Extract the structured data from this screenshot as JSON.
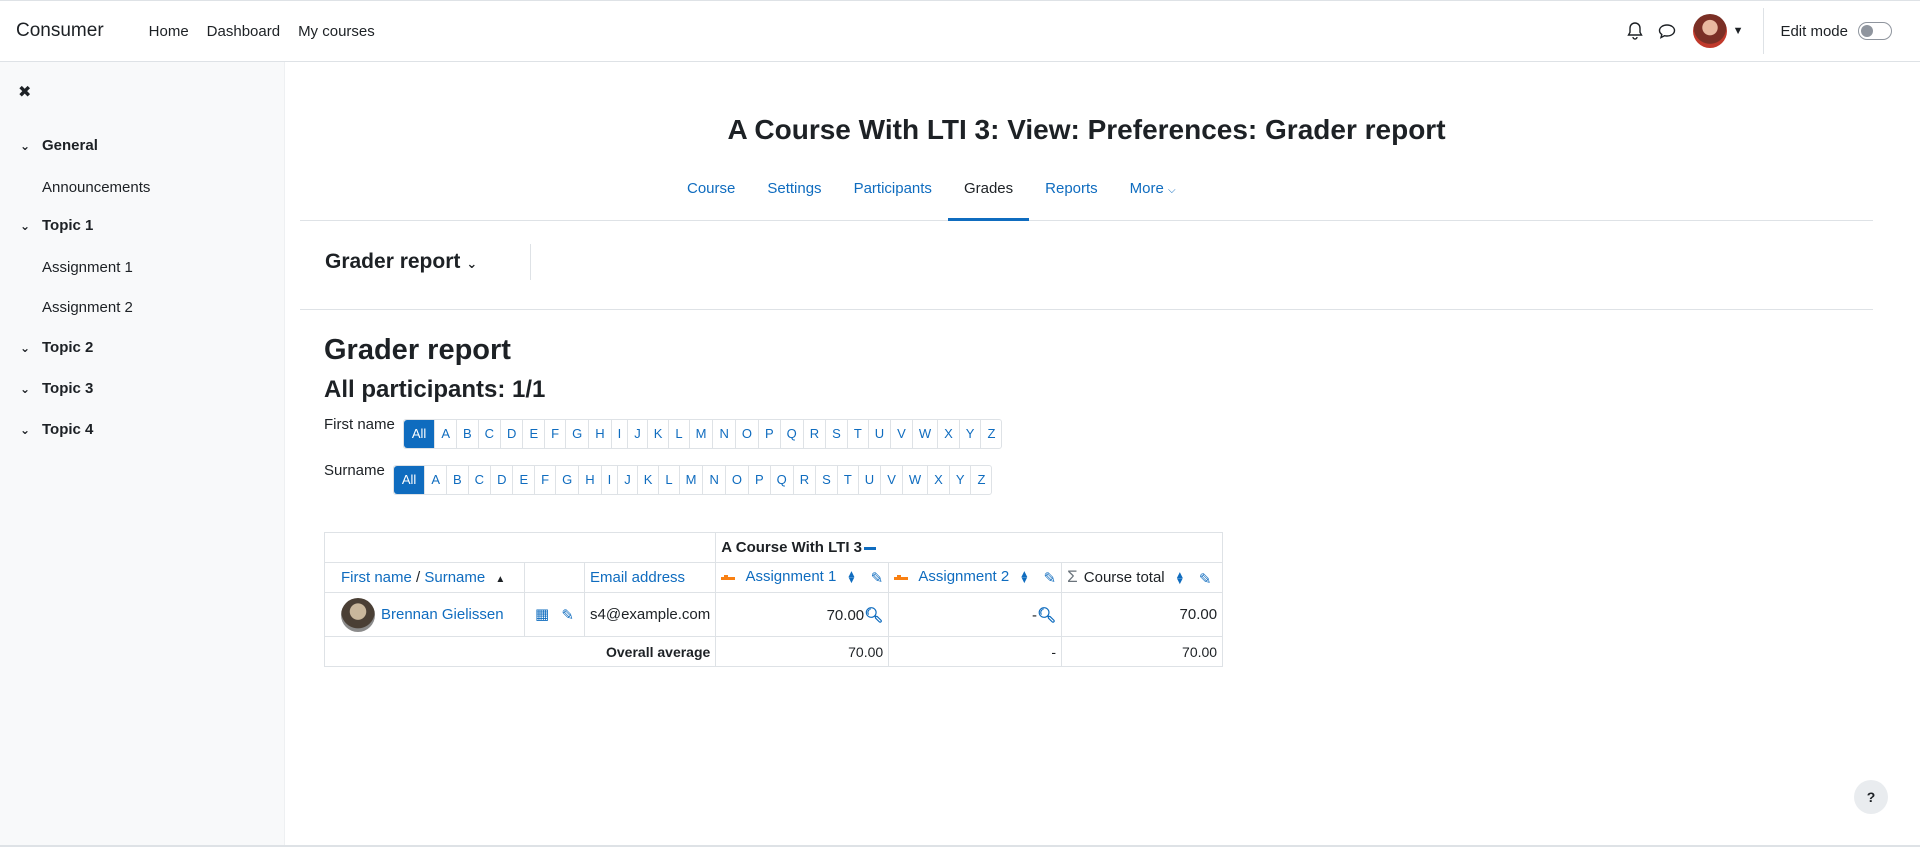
{
  "navbar": {
    "brand": "Consumer",
    "links": [
      "Home",
      "Dashboard",
      "My courses"
    ],
    "edit_mode_label": "Edit mode",
    "edit_mode_on": false
  },
  "drawer": {
    "close_icon": "close-icon",
    "sections": [
      {
        "title": "General",
        "items": [
          "Announcements"
        ]
      },
      {
        "title": "Topic 1",
        "items": [
          "Assignment 1",
          "Assignment 2"
        ]
      },
      {
        "title": "Topic 2",
        "items": []
      },
      {
        "title": "Topic 3",
        "items": []
      },
      {
        "title": "Topic 4",
        "items": []
      }
    ]
  },
  "page": {
    "title": "A Course With LTI 3: View: Preferences: Grader report",
    "tabs": [
      "Course",
      "Settings",
      "Participants",
      "Grades",
      "Reports",
      "More"
    ],
    "active_tab": "Grades",
    "report_selector": "Grader report",
    "heading": "Grader report",
    "subheading": "All participants: 1/1"
  },
  "initials": {
    "first_name_label": "First name",
    "surname_label": "Surname",
    "all_label": "All",
    "letters": [
      "A",
      "B",
      "C",
      "D",
      "E",
      "F",
      "G",
      "H",
      "I",
      "J",
      "K",
      "L",
      "M",
      "N",
      "O",
      "P",
      "Q",
      "R",
      "S",
      "T",
      "U",
      "V",
      "W",
      "X",
      "Y",
      "Z"
    ]
  },
  "grader": {
    "category": "A Course With LTI 3",
    "col_firstname": "First name",
    "col_sep": " / ",
    "col_surname": "Surname",
    "col_email": "Email address",
    "col_items": [
      "Assignment 1",
      "Assignment 2"
    ],
    "col_total": "Course total",
    "rows": [
      {
        "name": "Brennan Gielissen",
        "email": "s4@example.com",
        "grades": [
          "70.00",
          "-"
        ],
        "total": "70.00"
      }
    ],
    "average_label": "Overall average",
    "average": [
      "70.00",
      "-",
      "70.00"
    ]
  },
  "help_label": "?",
  "colors": {
    "accent": "#0f6cbf",
    "text": "#1d2125",
    "border": "#dee2e6",
    "drawer_bg": "#f8f9fa"
  }
}
